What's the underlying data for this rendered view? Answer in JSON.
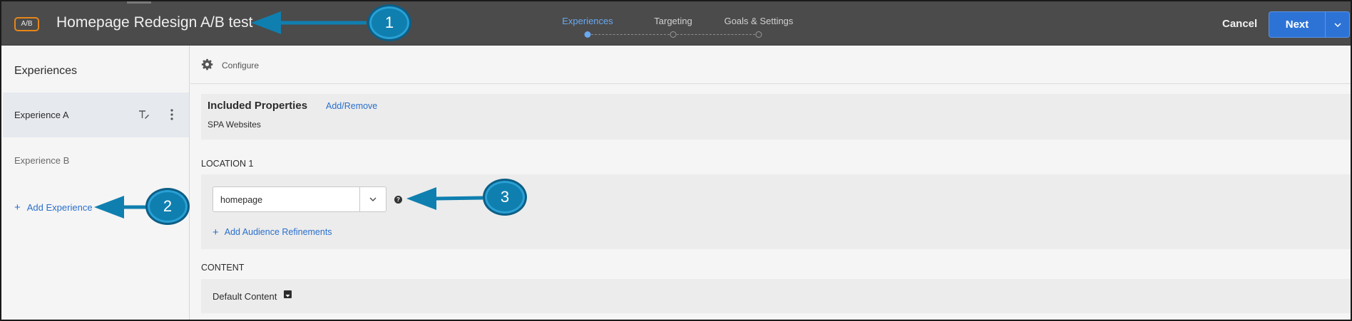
{
  "header": {
    "badge": "A/B",
    "title": "Homepage Redesign A/B test",
    "steps": [
      {
        "label": "Experiences",
        "active": true
      },
      {
        "label": "Targeting",
        "active": false
      },
      {
        "label": "Goals & Settings",
        "active": false
      }
    ],
    "cancel_label": "Cancel",
    "next_label": "Next"
  },
  "sidebar": {
    "title": "Experiences",
    "experiences": [
      {
        "label": "Experience A",
        "selected": true
      },
      {
        "label": "Experience B",
        "selected": false
      }
    ],
    "add_label": "Add Experience"
  },
  "main": {
    "configure_label": "Configure",
    "properties": {
      "title": "Included Properties",
      "link": "Add/Remove",
      "value": "SPA Websites"
    },
    "location": {
      "label": "LOCATION 1",
      "value": "homepage",
      "add_refinements": "Add Audience Refinements"
    },
    "content": {
      "label": "CONTENT",
      "value": "Default Content"
    }
  },
  "callouts": [
    "1",
    "2",
    "3"
  ],
  "colors": {
    "header_bg": "#4b4b4b",
    "accent_blue": "#2d73d6",
    "link_blue": "#2a6fcc",
    "badge_orange": "#e68619",
    "callout": "#0f7fb0"
  }
}
